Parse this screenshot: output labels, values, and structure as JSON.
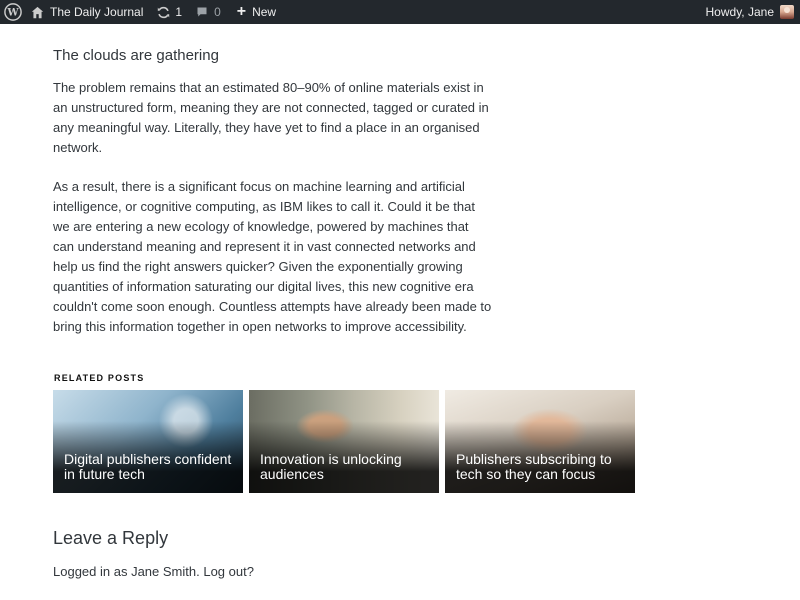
{
  "adminbar": {
    "site_name": "The Daily Journal",
    "updates_count": "1",
    "comments_count": "0",
    "new_label": "New",
    "howdy": "Howdy, Jane"
  },
  "article": {
    "section_heading": "The clouds are gathering",
    "paragraphs": [
      "The problem remains that an estimated 80–90% of online materials exist in an unstructured form, meaning they are not connected, tagged or curated in any meaningful way. Literally, they have yet to find a place in an organised network.",
      "As a result, there is a significant focus on machine learning and artificial intelligence, or cognitive computing, as IBM likes to call it. Could it be that we are entering a new ecology of knowledge, powered by machines that can understand meaning and represent it in vast connected networks and help us find the right answers quicker? Given the exponentially growing quantities of information saturating our digital lives, this new cognitive era couldn't come soon enough. Countless attempts have already been made to bring this information together in open networks to improve accessibility."
    ]
  },
  "related": {
    "heading": "RELATED POSTS",
    "posts": [
      {
        "title": "Digital publishers confident in future tech"
      },
      {
        "title": "Innovation is unlocking audiences"
      },
      {
        "title": "Publishers subscribing to tech so they can focus"
      }
    ]
  },
  "comments": {
    "heading": "Leave a Reply",
    "logged_in_prefix": "Logged in as Jane Smith.",
    "logout_label": "Log out?"
  },
  "colors": {
    "adminbar_bg": "#23282d",
    "text": "#32373c"
  }
}
